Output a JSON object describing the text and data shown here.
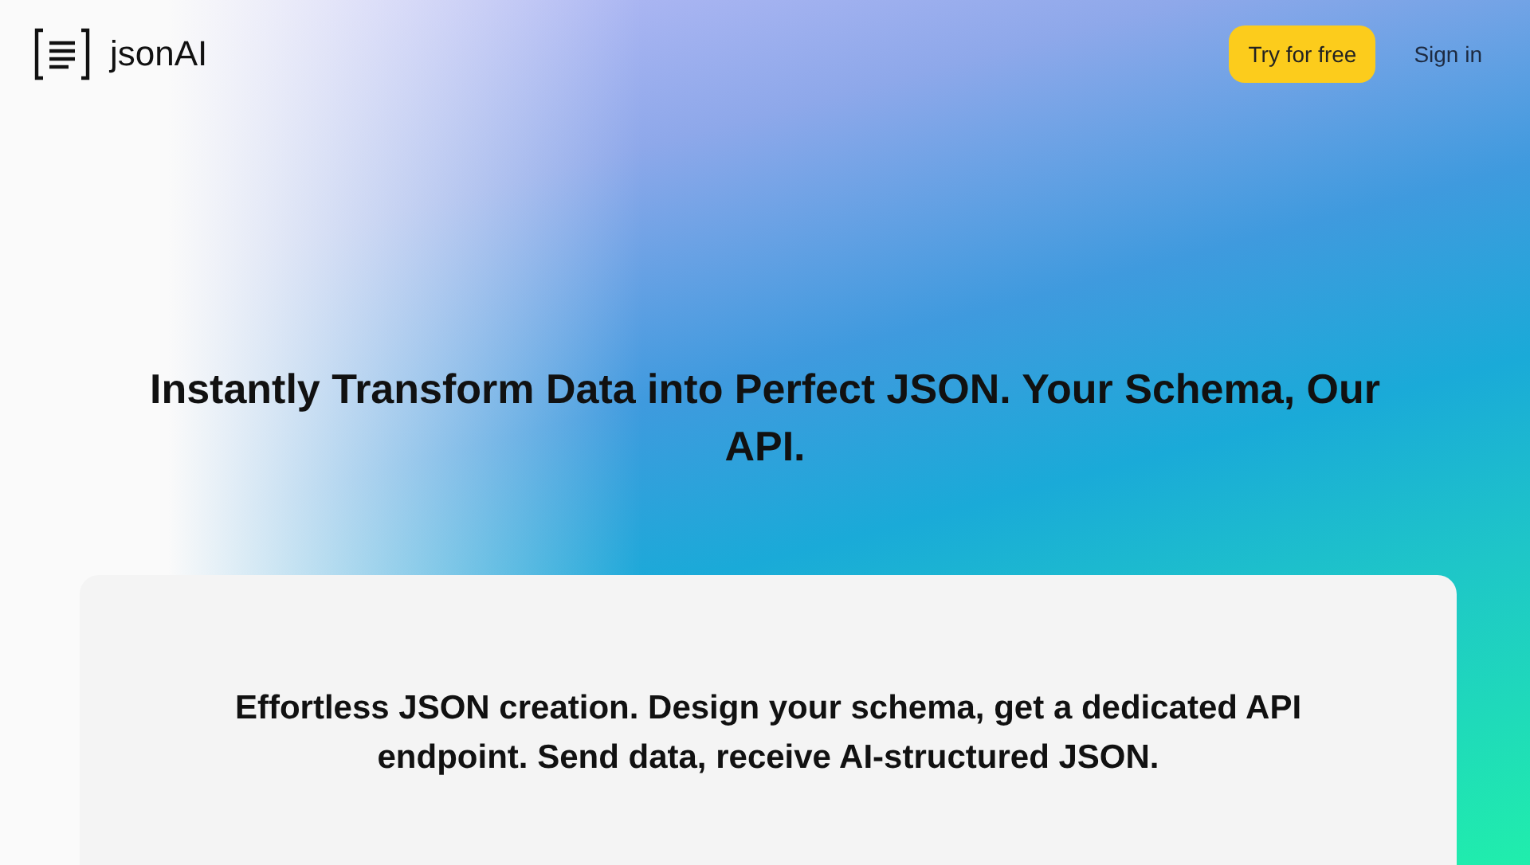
{
  "header": {
    "logo_text": "jsonAI",
    "buttons": [
      {
        "label": "Try for free",
        "kind": "primary"
      },
      {
        "label": "Sign in",
        "kind": "link"
      }
    ]
  },
  "hero": {
    "headline": "Instantly Transform Data into Perfect JSON. Your Schema, Our API."
  },
  "card": {
    "text": "Effortless JSON creation. Design your schema, get a dedicated API endpoint. Send data, receive AI-structured JSON."
  }
}
